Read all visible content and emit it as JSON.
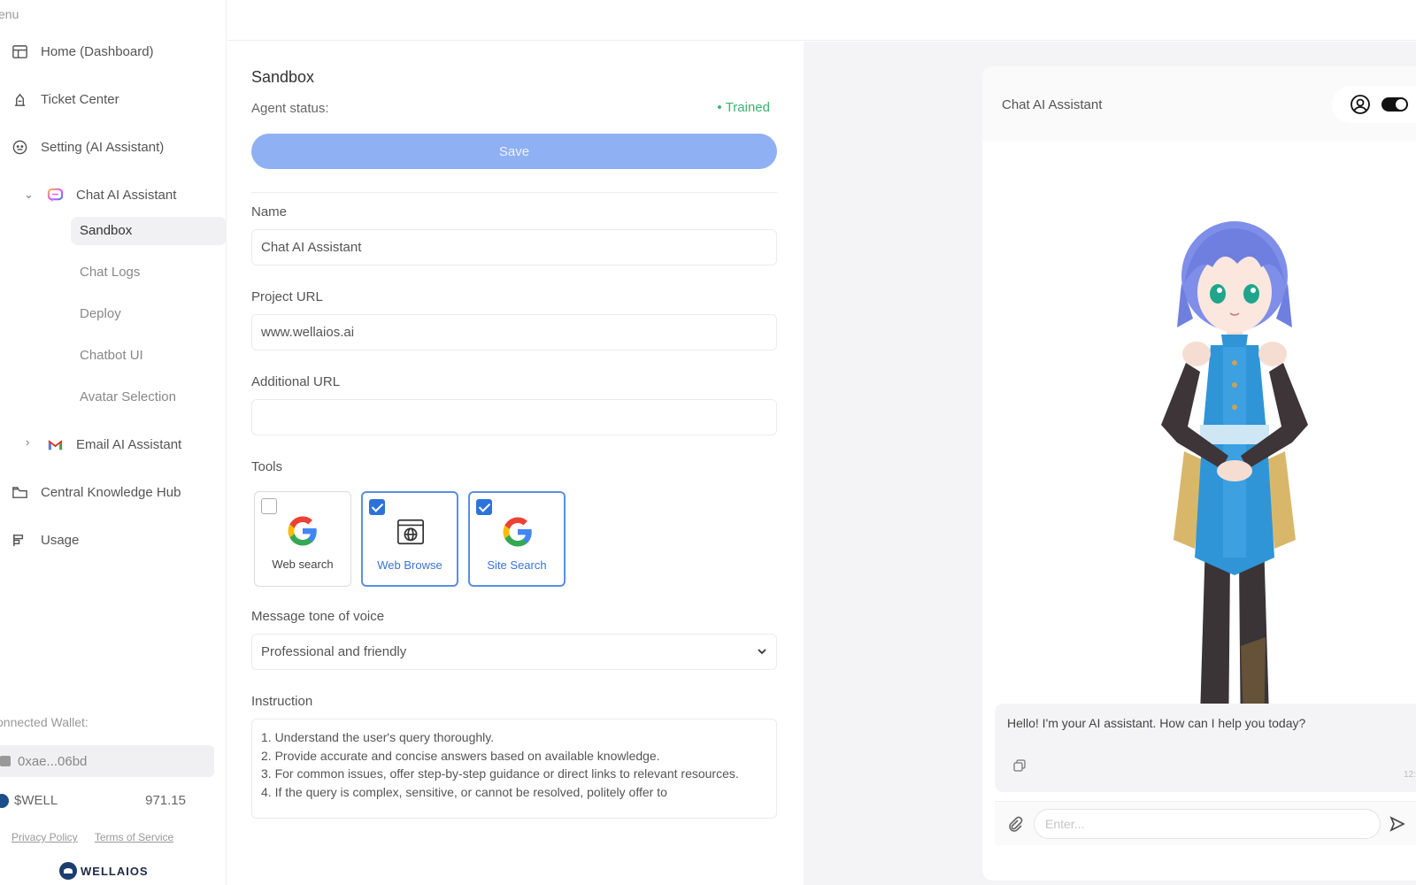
{
  "sidebar": {
    "menu_label": "enu",
    "items": [
      {
        "label": "Home (Dashboard)",
        "icon": "dashboard-icon"
      },
      {
        "label": "Ticket Center",
        "icon": "ticket-icon"
      },
      {
        "label": "Setting (AI Assistant)",
        "icon": "settings-icon"
      },
      {
        "label": "Chat AI Assistant",
        "icon": "chat-bubble-icon"
      },
      {
        "label": "Email AI Assistant",
        "icon": "gmail-icon"
      },
      {
        "label": "Central Knowledge Hub",
        "icon": "folder-icon"
      },
      {
        "label": "Usage",
        "icon": "usage-icon"
      }
    ],
    "chat_subitems": [
      {
        "label": "Sandbox",
        "active": true
      },
      {
        "label": "Chat Logs"
      },
      {
        "label": "Deploy"
      },
      {
        "label": "Chatbot UI"
      },
      {
        "label": "Avatar Selection"
      }
    ],
    "wallet_label": "onnected Wallet:",
    "wallet_address": "0xae...06bd",
    "token_name": "$WELL",
    "token_balance": "971.15",
    "privacy_link": "Privacy Policy",
    "terms_link": "Terms of Service",
    "logo_text": "WELLAIOS"
  },
  "form": {
    "title": "Sandbox",
    "status_label": "Agent status:",
    "status_value": "Trained",
    "save_label": "Save",
    "name_label": "Name",
    "name_value": "Chat AI Assistant",
    "project_url_label": "Project URL",
    "project_url_value": "www.wellaios.ai",
    "additional_url_label": "Additional URL",
    "additional_url_value": "",
    "tools_label": "Tools",
    "tools": [
      {
        "label": "Web search",
        "checked": false,
        "icon": "google-icon"
      },
      {
        "label": "Web Browse",
        "checked": true,
        "icon": "browser-globe-icon"
      },
      {
        "label": "Site Search",
        "checked": true,
        "icon": "google-icon"
      }
    ],
    "tone_label": "Message tone of voice",
    "tone_value": "Professional and friendly",
    "instruction_label": "Instruction",
    "instruction_lines": [
      "1. Understand the user's query thoroughly.",
      "2. Provide accurate and concise answers based on available knowledge.",
      "3. For common issues, offer step-by-step guidance or direct links to relevant resources.",
      "4. If the query is complex, sensitive, or cannot be resolved, politely offer to"
    ]
  },
  "chat": {
    "title": "Chat AI Assistant",
    "greeting": "Hello! I'm your AI assistant. How can I help you today?",
    "time": "12:",
    "input_placeholder": "Enter..."
  },
  "colors": {
    "accent": "#8fb0f2",
    "checked_border": "#5a8ee8",
    "status_green": "#3cb371"
  }
}
